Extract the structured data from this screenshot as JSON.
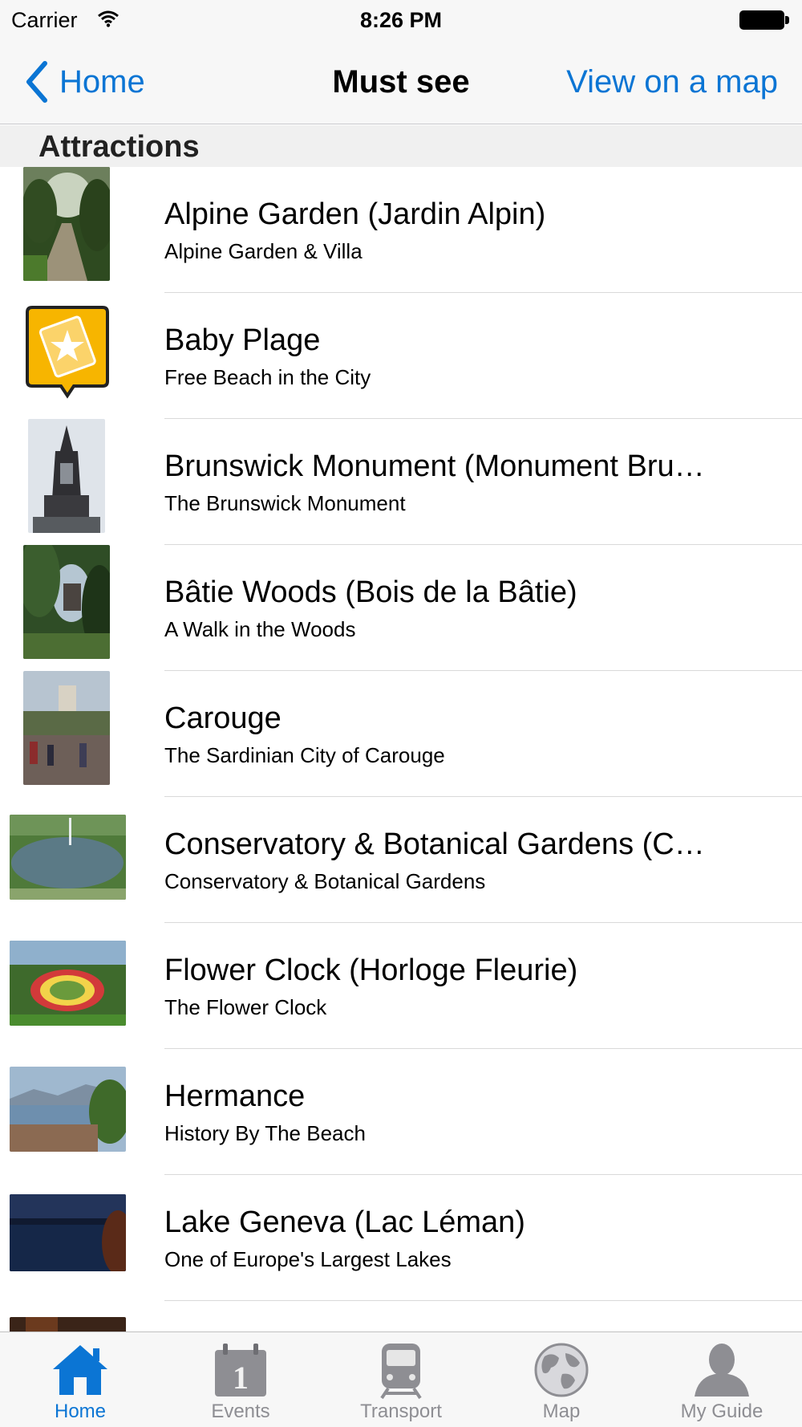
{
  "status_bar": {
    "carrier": "Carrier",
    "time": "8:26 PM",
    "wifi_icon": "wifi-icon",
    "battery_icon": "battery-icon"
  },
  "nav": {
    "back_label": "Home",
    "title": "Must see",
    "right_action": "View on a map",
    "back_icon": "chevron-left-icon"
  },
  "section": {
    "title": "Attractions"
  },
  "items": [
    {
      "title": "Alpine Garden (Jardin Alpin)",
      "subtitle": "Alpine Garden & Villa"
    },
    {
      "title": "Baby Plage",
      "subtitle": "Free Beach in the City"
    },
    {
      "title": "Brunswick Monument (Monument Bru…",
      "subtitle": "The Brunswick Monument"
    },
    {
      "title": "Bâtie Woods (Bois de la Bâtie)",
      "subtitle": "A Walk in the Woods"
    },
    {
      "title": "Carouge",
      "subtitle": "The Sardinian City of Carouge"
    },
    {
      "title": "Conservatory & Botanical Gardens (C…",
      "subtitle": "Conservatory & Botanical Gardens"
    },
    {
      "title": "Flower Clock (Horloge Fleurie)",
      "subtitle": "The Flower Clock"
    },
    {
      "title": "Hermance",
      "subtitle": "History By The Beach"
    },
    {
      "title": "Lake Geneva (Lac Léman)",
      "subtitle": "One of Europe's Largest Lakes"
    }
  ],
  "tabs": [
    {
      "label": "Home",
      "icon": "home-icon",
      "active": true
    },
    {
      "label": "Events",
      "icon": "calendar-icon",
      "active": false
    },
    {
      "label": "Transport",
      "icon": "train-icon",
      "active": false
    },
    {
      "label": "Map",
      "icon": "globe-icon",
      "active": false
    },
    {
      "label": "My Guide",
      "icon": "person-icon",
      "active": false
    }
  ],
  "colors": {
    "accent": "#0b75d4",
    "inactive": "#8e8e93",
    "badge": "#f7b500"
  }
}
